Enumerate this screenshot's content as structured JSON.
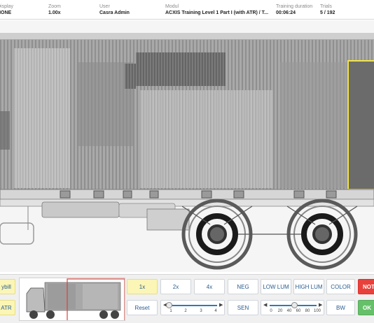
{
  "header": {
    "display": {
      "label": "Display",
      "value": "NONE"
    },
    "zoom": {
      "label": "Zoom",
      "value": "1.00x"
    },
    "user": {
      "label": "User",
      "value": "Casra Admin"
    },
    "module": {
      "label": "Modul",
      "value": "ACXIS Training Level 1 Part I (with ATR) / T..."
    },
    "duration": {
      "label": "Training duration",
      "value": "00:06:24"
    },
    "trials": {
      "label": "Trials",
      "value": "5 / 192"
    }
  },
  "scan": {
    "description_icon": "xray-truck-image",
    "highlight_color": "#f2e34a"
  },
  "left_buttons": {
    "waybill": "ybill",
    "atr": "ATR"
  },
  "zoom_buttons": {
    "one": "1x",
    "two": "2x",
    "four": "4x",
    "reset": "Reset"
  },
  "zoom_slider": {
    "ticks": [
      "1",
      "2",
      "3",
      "4"
    ],
    "value": 1
  },
  "image_buttons": {
    "neg": "NEG",
    "low_lum": "LOW LUM",
    "high_lum": "HIGH LUM",
    "color": "COLOR",
    "sen": "SEN",
    "bw": "BW"
  },
  "lum_slider": {
    "ticks": [
      "0",
      "20",
      "40",
      "60",
      "80",
      "100"
    ],
    "value": 50
  },
  "decision_buttons": {
    "not_ok": "NOT",
    "ok": "OK"
  },
  "colors": {
    "active_button": "#fbf6b6",
    "not_ok": "#e8413b",
    "ok": "#66c06a",
    "link_text": "#2a5d8f"
  }
}
